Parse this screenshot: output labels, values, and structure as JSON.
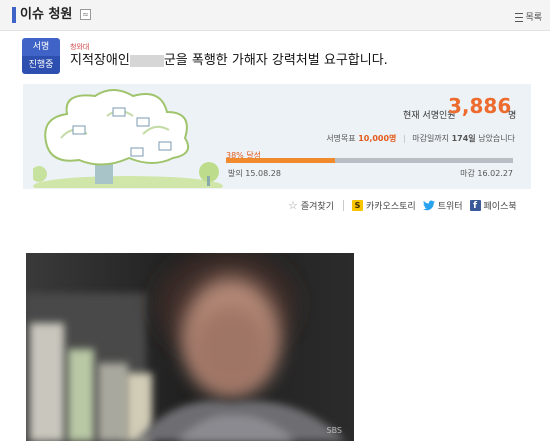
{
  "header": {
    "title": "이슈 청원",
    "rss_icon": "rss-icon",
    "list_label": "목록"
  },
  "petition": {
    "badge_top": "서명",
    "badge_bottom": "진행중",
    "source": "청와대",
    "title_before_mask": "지적장애인",
    "title_after_mask": "군을 폭행한 가해자 강력처벌 요구합니다."
  },
  "progress": {
    "current_label": "현재 서명인원",
    "current_value": "3,886",
    "current_unit": "명",
    "goal_label": "서명목표",
    "goal_value": "10,000명",
    "deadline_text": "마감일까지",
    "days_left": "174일",
    "remain_text": "남았습니다",
    "percent_label": "38% 달성",
    "percent": 38,
    "start_label": "발의",
    "start_date": "15.08.28",
    "end_label": "마감",
    "end_date": "16.02.27"
  },
  "share": {
    "bookmark": "즐겨찾기",
    "kakaostory": "카카오스토리",
    "twitter": "트위터",
    "facebook": "페이스북"
  },
  "video": {
    "watermark": "SBS"
  },
  "colors": {
    "accent_blue": "#3f63c7",
    "accent_orange": "#ec6b2d",
    "panel_bg": "#edf2f7"
  }
}
